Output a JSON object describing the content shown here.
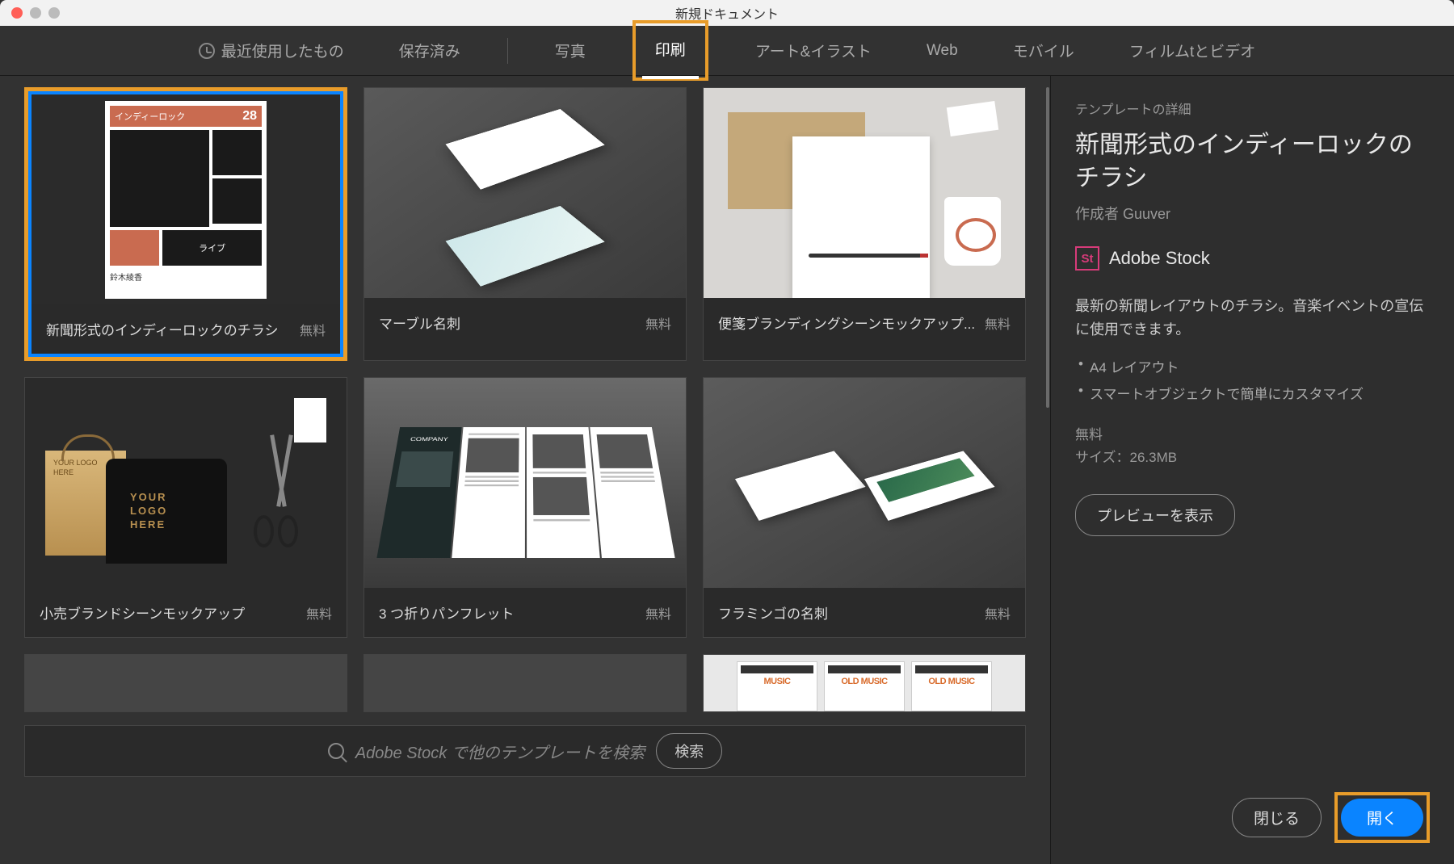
{
  "window": {
    "title": "新規ドキュメント"
  },
  "tabs": {
    "recent": "最近使用したもの",
    "saved": "保存済み",
    "photo": "写真",
    "print": "印刷",
    "art": "アート&イラスト",
    "web": "Web",
    "mobile": "モバイル",
    "film": "フィルムtとビデオ"
  },
  "templates": [
    {
      "title": "新聞形式のインディーロックのチラシ",
      "price": "無料"
    },
    {
      "title": "マーブル名刺",
      "price": "無料"
    },
    {
      "title": "便箋ブランディングシーンモックアップ...",
      "price": "無料"
    },
    {
      "title": "小売ブランドシーンモックアップ",
      "price": "無料"
    },
    {
      "title": "3 つ折りパンフレット",
      "price": "無料"
    },
    {
      "title": "フラミンゴの名刺",
      "price": "無料"
    }
  ],
  "thumb1": {
    "header": "インディーロック",
    "num": "28",
    "name": "鈴木綾香",
    "live": "ライブ"
  },
  "thumb4": {
    "logo": "YOUR\nLOGO\nHERE"
  },
  "thumb5": {
    "company": "COMPANY"
  },
  "thumb9": {
    "old": "OLD MUSIC",
    "music": "MUSIC"
  },
  "search": {
    "placeholder": "Adobe Stock で他のテンプレートを検索",
    "button": "検索"
  },
  "details": {
    "label": "テンプレートの詳細",
    "title": "新聞形式のインディーロックのチラシ",
    "author": "作成者 Guuver",
    "stock_icon": "St",
    "stock_label": "Adobe Stock",
    "description": "最新の新聞レイアウトのチラシ。音楽イベントの宣伝に使用できます。",
    "bullets": [
      "A4 レイアウト",
      "スマートオブジェクトで簡単にカスタマイズ"
    ],
    "price": "無料",
    "size": "サイズ：26.3MB",
    "preview_btn": "プレビューを表示",
    "close_btn": "閉じる",
    "open_btn": "開く"
  }
}
